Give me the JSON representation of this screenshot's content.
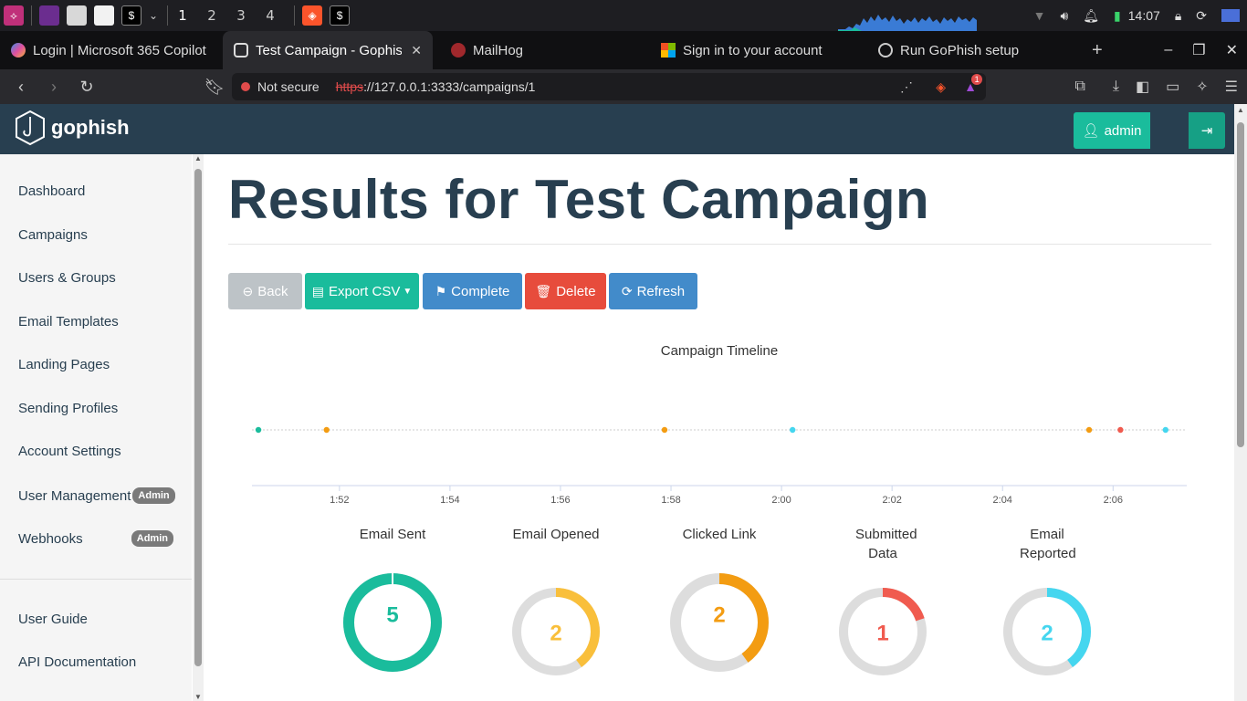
{
  "taskbar": {
    "workspaces": [
      "1",
      "2",
      "3",
      "4"
    ],
    "clock": "14:07"
  },
  "browser": {
    "tabs": [
      {
        "label": "Login | Microsoft 365 Copilot"
      },
      {
        "label": "Test Campaign - Gophish",
        "active": true
      },
      {
        "label": "MailHog"
      },
      {
        "label": "Sign in to your account"
      },
      {
        "label": "Run GoPhish setup"
      }
    ],
    "security_label": "Not secure",
    "url_scheme": "https",
    "url_rest": "://127.0.0.1:3333/campaigns/1",
    "notification_count": "1"
  },
  "app": {
    "brand": "gophish",
    "user_label": "admin"
  },
  "sidebar": {
    "items": [
      {
        "label": "Dashboard"
      },
      {
        "label": "Campaigns"
      },
      {
        "label": "Users & Groups"
      },
      {
        "label": "Email Templates"
      },
      {
        "label": "Landing Pages"
      },
      {
        "label": "Sending Profiles"
      },
      {
        "label": "Account Settings"
      },
      {
        "label": "User Management",
        "badge": "Admin"
      },
      {
        "label": "Webhooks",
        "badge": "Admin"
      },
      {
        "label": "User Guide"
      },
      {
        "label": "API Documentation"
      }
    ]
  },
  "main": {
    "title": "Results for Test Campaign",
    "buttons": {
      "back": "Back",
      "export": "Export CSV",
      "complete": "Complete",
      "delete": "Delete",
      "refresh": "Refresh"
    },
    "timeline_title": "Campaign Timeline"
  },
  "colors": {
    "sent": "#1abc9c",
    "opened": "#f9bf3b",
    "clicked": "#f39c12",
    "submitted": "#f05b4f",
    "reported": "#45d6ef",
    "navbar": "#283f50"
  },
  "chart_data": [
    {
      "type": "scatter",
      "title": "Campaign Timeline",
      "x_ticks": [
        "1:52",
        "1:54",
        "1:56",
        "1:58",
        "2:00",
        "2:02",
        "2:04",
        "2:06"
      ],
      "xlim": [
        "1:50:25",
        "2:07:20"
      ],
      "events": [
        {
          "time": "1:50:32",
          "kind": "sent",
          "color": "#1abc9c"
        },
        {
          "time": "1:51:46",
          "kind": "opened",
          "color": "#f39c12"
        },
        {
          "time": "1:57:53",
          "kind": "opened",
          "color": "#f39c12"
        },
        {
          "time": "2:00:12",
          "kind": "reported",
          "color": "#45d6ef"
        },
        {
          "time": "2:05:34",
          "kind": "clicked",
          "color": "#f39c12"
        },
        {
          "time": "2:06:08",
          "kind": "submitted",
          "color": "#f05b4f"
        },
        {
          "time": "2:06:57",
          "kind": "reported",
          "color": "#45d6ef"
        }
      ]
    },
    {
      "type": "pie",
      "stats": [
        {
          "label": "Email Sent",
          "value": 5,
          "total": 5,
          "color": "#1abc9c"
        },
        {
          "label": "Email Opened",
          "value": 2,
          "total": 5,
          "color": "#f9bf3b"
        },
        {
          "label": "Clicked Link",
          "value": 2,
          "total": 5,
          "color": "#f39c12"
        },
        {
          "label": "Submitted Data",
          "value": 1,
          "total": 5,
          "color": "#f05b4f"
        },
        {
          "label": "Email Reported",
          "value": 2,
          "total": 5,
          "color": "#45d6ef"
        }
      ]
    }
  ]
}
